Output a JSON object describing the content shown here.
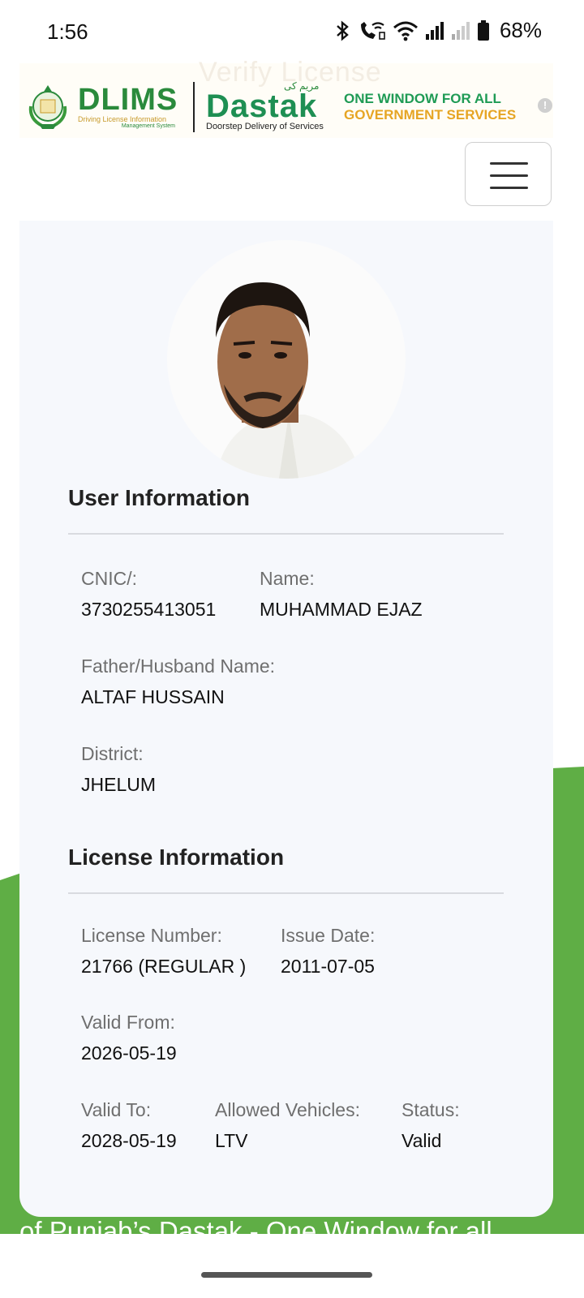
{
  "status_bar": {
    "time": "1:56",
    "battery_percent": "68%"
  },
  "header": {
    "faded_title": "Verify License",
    "dlims": {
      "name": "DLIMS",
      "subtitle": "Driving License Information",
      "subtitle2": "Management System"
    },
    "dastak": {
      "urdu": "مریم کی",
      "name": "Dastak",
      "tagline": "Doorstep Delivery of Services"
    },
    "one_window": {
      "line1": "ONE WINDOW FOR ALL",
      "line2": "GOVERNMENT SERVICES"
    },
    "info_symbol": "!"
  },
  "user_information": {
    "title": "User Information",
    "cnic_label": "CNIC/:",
    "cnic_value": "3730255413051",
    "name_label": "Name:",
    "name_value": "MUHAMMAD EJAZ",
    "father_label": "Father/Husband Name:",
    "father_value": "ALTAF HUSSAIN",
    "district_label": "District:",
    "district_value": "JHELUM"
  },
  "license_information": {
    "title": "License Information",
    "license_number_label": "License Number:",
    "license_number_value": "21766 (REGULAR )",
    "issue_date_label": "Issue Date:",
    "issue_date_value": "2011-07-05",
    "valid_from_label": "Valid From:",
    "valid_from_value": "2026-05-19",
    "valid_to_label": "Valid To:",
    "valid_to_value": "2028-05-19",
    "allowed_vehicles_label": "Allowed Vehicles:",
    "allowed_vehicles_value": "LTV",
    "status_label": "Status:",
    "status_value": "Valid"
  },
  "footer": {
    "marquee_text": "of Punjab’s Dastak - One Window for all"
  },
  "colors": {
    "green_bg": "#5fae45",
    "card_bg": "#f6f8fc",
    "dlims_green": "#2a8a3c",
    "gold": "#e6a524"
  },
  "icons": [
    "bluetooth-icon",
    "wifi-calling-icon",
    "wifi-icon",
    "signal-icon",
    "signal-weak-icon",
    "battery-icon",
    "hamburger-menu-icon",
    "info-icon",
    "profile-photo"
  ]
}
